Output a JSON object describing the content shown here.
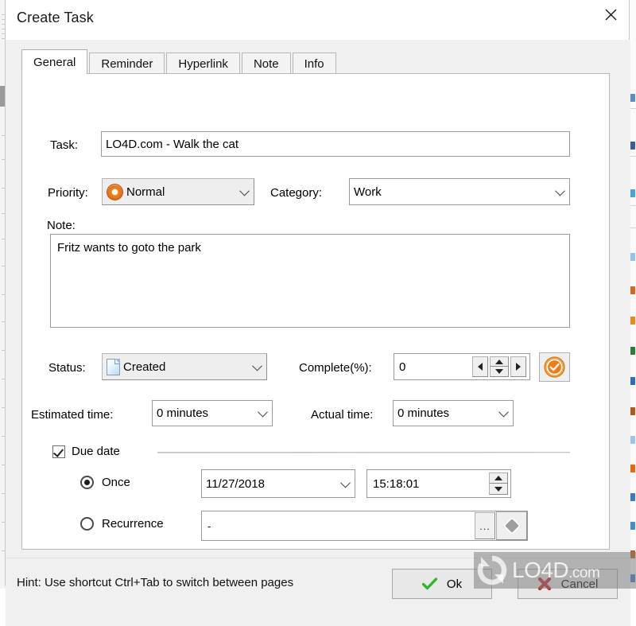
{
  "window": {
    "title": "Create Task",
    "close_icon": "close-icon"
  },
  "tabs": [
    {
      "label": "General",
      "active": true
    },
    {
      "label": "Reminder",
      "active": false
    },
    {
      "label": "Hyperlink",
      "active": false
    },
    {
      "label": "Note",
      "active": false
    },
    {
      "label": "Info",
      "active": false
    }
  ],
  "general": {
    "task": {
      "label": "Task:",
      "value": "LO4D.com - Walk the cat"
    },
    "priority": {
      "label": "Priority:",
      "value": "Normal",
      "icon": "priority-donut-icon"
    },
    "category": {
      "label": "Category:",
      "value": "Work"
    },
    "note": {
      "label": "Note:",
      "value": "Fritz wants to goto the park"
    },
    "status": {
      "label": "Status:",
      "value": "Created",
      "icon": "document-icon"
    },
    "complete": {
      "label": "Complete(%):",
      "value": "0",
      "seal_button_icon": "orange-check-seal-icon"
    },
    "estimated_time": {
      "label": "Estimated time:",
      "value": "0 minutes"
    },
    "actual_time": {
      "label": "Actual time:",
      "value": "0 minutes"
    },
    "due_date": {
      "label": "Due date",
      "checked": true,
      "once": {
        "label": "Once",
        "selected": true,
        "date": "11/27/2018",
        "time": "15:18:01"
      },
      "recurrence": {
        "label": "Recurrence",
        "selected": false,
        "value": "-",
        "browse_label": "...",
        "edit_icon": "diamond-edit-icon"
      }
    }
  },
  "footer": {
    "hint": "Hint: Use shortcut Ctrl+Tab to switch between pages",
    "ok_label": "Ok",
    "cancel_label": "Cancel",
    "ok_icon": "green-check-icon",
    "cancel_icon": "red-x-icon"
  },
  "watermark": {
    "text": "LO4D",
    "suffix": ".com",
    "icon": "refresh-circle-icon"
  },
  "colors": {
    "accent_orange": "#e2721a",
    "ok_green": "#2fb52f",
    "cancel_red": "#c22a2a",
    "dialog_bg": "#f0f0f0",
    "page_bg": "#ffffff"
  }
}
